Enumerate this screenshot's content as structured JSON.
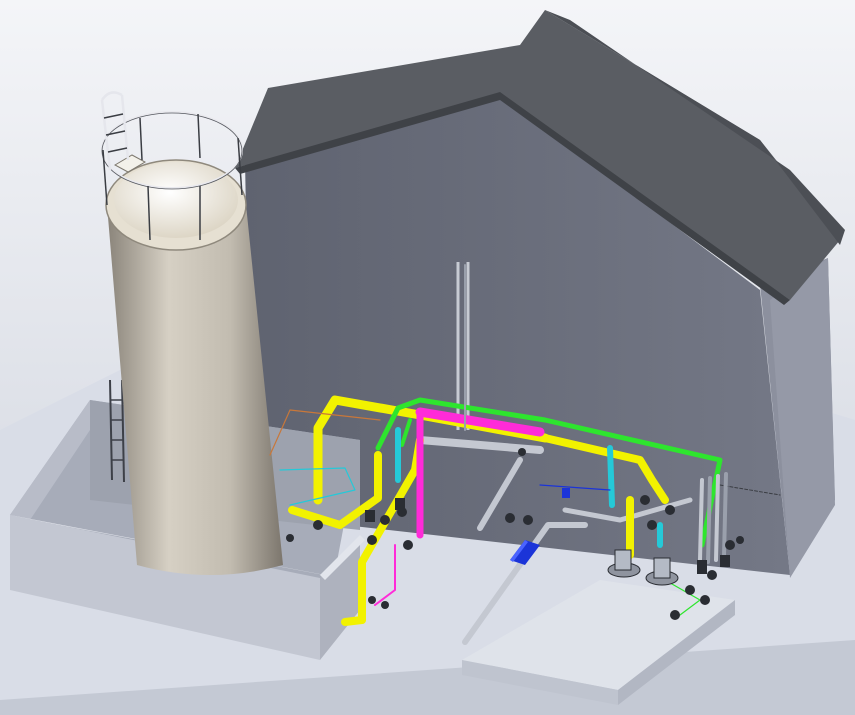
{
  "scene": {
    "colors": {
      "background_top": "#e9ecf2",
      "background_mid": "#c9ced8",
      "floor_slab": "#d7dbe6",
      "building_wall": "#6a6e7b",
      "building_side": "#8e92a0",
      "roof": "#56595f",
      "silo_body": "#c9c3b8",
      "silo_top": "#f2efe6",
      "pit_wall": "#b8bcc8",
      "pipe_yellow": "#f2f200",
      "pipe_green": "#2ee52e",
      "pipe_magenta": "#ff2bd8",
      "pipe_cyan": "#25c9d8",
      "pipe_blue": "#1b34d8",
      "pipe_grey": "#b9bec8",
      "pump_dark": "#2a2d33"
    },
    "components": [
      "silo",
      "ladder",
      "railing",
      "pit",
      "building",
      "roof",
      "pipe-rack",
      "pumps",
      "valves",
      "concrete-pad"
    ]
  }
}
